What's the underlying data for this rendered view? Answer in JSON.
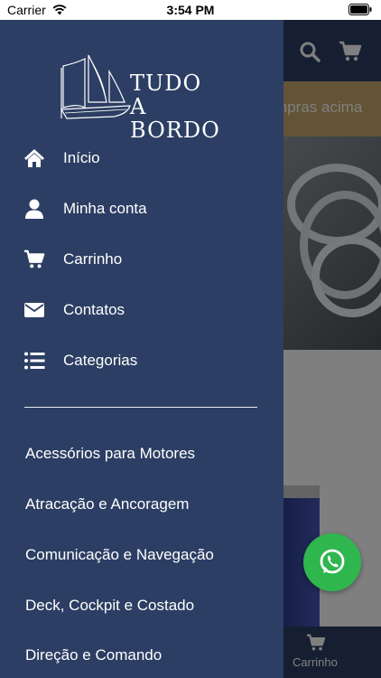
{
  "status_bar": {
    "carrier": "Carrier",
    "time": "3:54 PM"
  },
  "header": {
    "promo_text": "mpras acima"
  },
  "bottom_tab": {
    "cart_label": "Carrinho"
  },
  "brand": {
    "logo_line1": "TUDO A",
    "logo_line2": "BORDO"
  },
  "drawer": {
    "menu": [
      {
        "label": "Início",
        "icon": "home-icon"
      },
      {
        "label": "Minha conta",
        "icon": "user-icon"
      },
      {
        "label": "Carrinho",
        "icon": "cart-icon"
      },
      {
        "label": "Contatos",
        "icon": "envelope-icon"
      },
      {
        "label": "Categorias",
        "icon": "list-icon"
      }
    ],
    "categories": [
      "Acessórios para Motores",
      "Atracação e Ancoragem",
      "Comunicação e Navegação",
      "Deck, Cockpit e Costado",
      "Direção e Comando"
    ]
  },
  "colors": {
    "brand_navy": "#2c3e63",
    "promo_gold": "#c6a86b",
    "whatsapp_green": "#2fb64f"
  }
}
